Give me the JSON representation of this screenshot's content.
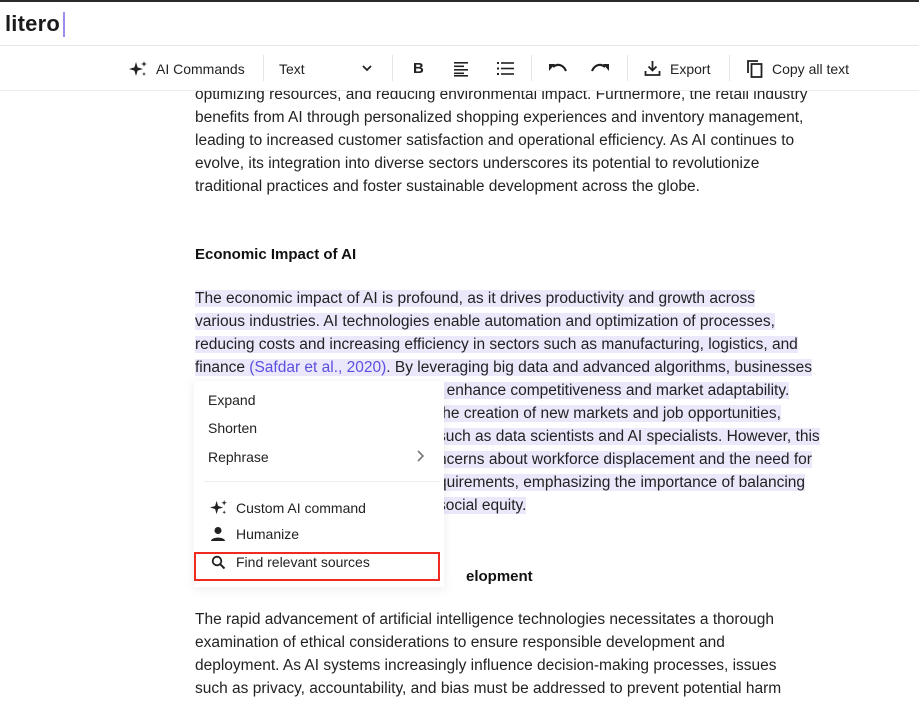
{
  "app": {
    "logo": "litero"
  },
  "toolbar": {
    "ai_commands_label": "AI Commands",
    "text_style_value": "Text",
    "bold_label": "B",
    "export_label": "Export",
    "copy_label": "Copy all text",
    "icons": [
      "sparkle-icon",
      "chevron-down-icon",
      "bold-icon",
      "align-left-icon",
      "bullet-list-icon",
      "undo-icon",
      "redo-icon",
      "download-icon",
      "copy-icon"
    ]
  },
  "document": {
    "para1_lines": [
      "optimizing resources, and reducing environmental impact. Furthermore, the retail industry",
      "benefits from AI through personalized shopping experiences and inventory management,",
      "leading to increased customer satisfaction and operational efficiency. As AI continues to",
      "evolve, its integration into diverse sectors underscores its potential to revolutionize",
      "traditional practices and foster sustainable development across the globe."
    ],
    "heading1": "Economic Impact of AI",
    "para2_lines": [
      "The economic impact of AI is profound, as it drives productivity and growth across",
      "various industries. AI technologies enable automation and optimization of processes,",
      "reducing costs and increasing efficiency in sectors such as manufacturing, logistics, and"
    ],
    "para2_line4_before": "finance ",
    "para2_citation": "(Safdar et al., 2020)",
    "para2_line4_after": ". By leveraging big data and advanced algorithms, businesses",
    "para2_visible_tails": [
      ": enhance competitiveness and market adaptability.",
      " the creation of new markets and job opportunities,",
      " such as data scientists and AI specialists. However, this",
      "ncerns about workforce displacement and the need for",
      "quirements, emphasizing the importance of balancing",
      "social equity."
    ],
    "heading2_visible": "elopment",
    "para3_lines": [
      "The rapid advancement of artificial intelligence technologies necessitates a thorough",
      "examination of ethical considerations to ensure responsible development and",
      "deployment. As AI systems increasingly influence decision-making processes, issues",
      "such as privacy, accountability, and bias must be addressed to prevent potential harm"
    ]
  },
  "context_menu": {
    "items": [
      {
        "label": "Expand"
      },
      {
        "label": "Shorten"
      },
      {
        "label": "Rephrase",
        "submenu": true
      },
      {
        "label": "Custom AI command",
        "icon": "sparkle-icon"
      },
      {
        "label": "Humanize",
        "icon": "person-icon"
      },
      {
        "label": "Find relevant sources",
        "icon": "search-icon",
        "highlighted": true
      }
    ]
  },
  "colors": {
    "selection_highlight": "#ebe8fb",
    "citation": "#5b4fe0",
    "annotation_box": "#ef2a1f",
    "caret": "#9b8cf0"
  }
}
